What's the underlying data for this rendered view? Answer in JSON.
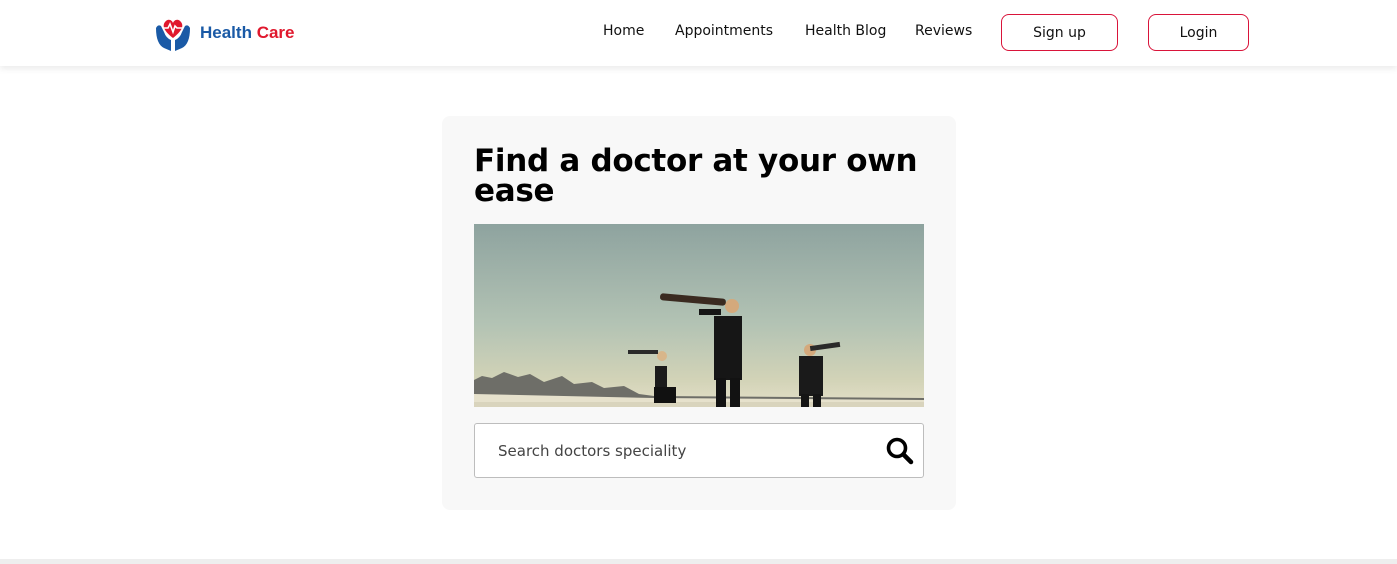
{
  "brand": {
    "word1": "Health",
    "word2": "Care"
  },
  "nav": {
    "links": [
      {
        "label": "Home"
      },
      {
        "label": "Appointments"
      },
      {
        "label": "Health Blog"
      },
      {
        "label": "Reviews"
      }
    ],
    "signup_label": "Sign up",
    "login_label": "Login"
  },
  "hero": {
    "title": "Find a doctor at your own ease",
    "image_subject": "three people in suits looking through telescopes in a desert"
  },
  "search": {
    "placeholder": "Search doctors speciality",
    "value": ""
  },
  "colors": {
    "accent": "#d9143a",
    "brand_blue": "#1a5aa6",
    "brand_red": "#e0182d"
  }
}
